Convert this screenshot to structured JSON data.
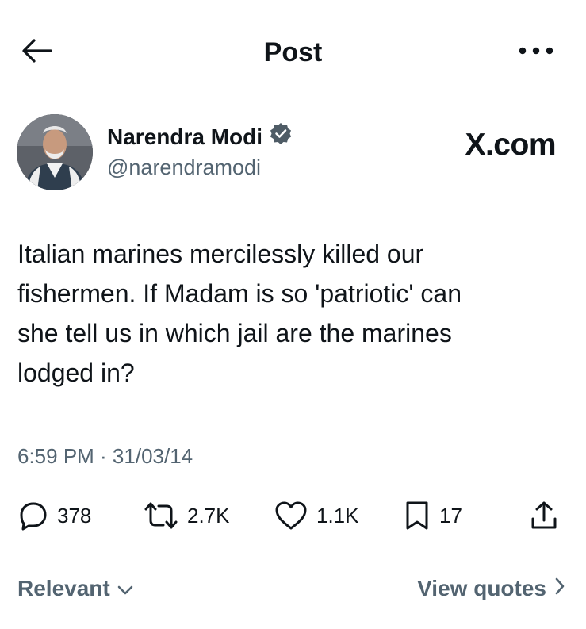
{
  "header": {
    "title": "Post",
    "back_icon": "arrow-left-icon",
    "more_icon": "more-horizontal-icon"
  },
  "author": {
    "name": "Narendra Modi",
    "handle": "@narendramodi",
    "verified_icon": "verified-badge-icon",
    "verified_color": "#4f5c66"
  },
  "watermark": {
    "text": "X.com"
  },
  "post": {
    "text": "Italian marines mercilessly killed our\nfishermen. If Madam is so 'patriotic' can\nshe tell us in which jail are the marines\nlodged in?",
    "timestamp": "6:59 PM · 31/03/14"
  },
  "actions": {
    "replies": {
      "icon": "reply-icon",
      "count": "378"
    },
    "reposts": {
      "icon": "repost-icon",
      "count": "2.7K"
    },
    "likes": {
      "icon": "heart-icon",
      "count": "1.1K"
    },
    "bookmarks": {
      "icon": "bookmark-icon",
      "count": "17"
    },
    "share": {
      "icon": "share-icon"
    }
  },
  "footer": {
    "sort_label": "Relevant",
    "quotes_label": "View quotes"
  },
  "colors": {
    "text": "#0f1419",
    "muted": "#536471",
    "background": "#ffffff"
  }
}
